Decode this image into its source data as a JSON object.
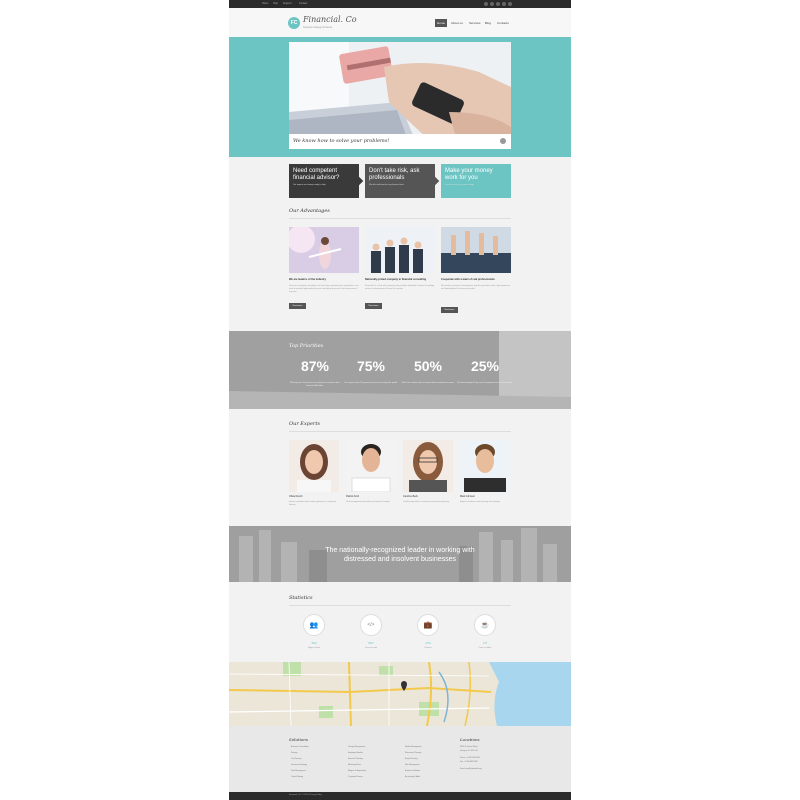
{
  "colors": {
    "accent": "#6cc5c3",
    "dark": "#333333",
    "gray": "#555555"
  },
  "topbar": {
    "links": [
      "Home",
      "Help",
      "Support",
      "Contact"
    ],
    "social_icons": [
      "facebook-icon",
      "twitter-icon",
      "google-icon",
      "linkedin-icon",
      "rss-icon"
    ]
  },
  "header": {
    "logo_text": "FC",
    "brand": "Financial. Co",
    "tagline": "business strategy & finance",
    "nav": [
      {
        "label": "Home",
        "active": true
      },
      {
        "label": "About us",
        "active": false
      },
      {
        "label": "Services",
        "active": false
      },
      {
        "label": "Blog",
        "active": false
      },
      {
        "label": "Contacts",
        "active": false
      }
    ]
  },
  "hero": {
    "caption": "We know how to solve your problems!"
  },
  "promos": [
    {
      "title": "Need competent financial advisor?",
      "sub": "Our experts are always ready to help"
    },
    {
      "title": "Don't take risk, ask professionals",
      "sub": "We offer solutions for any financial task"
    },
    {
      "title": "Make your money work for you",
      "sub": "Learn how to invest your savings"
    }
  ],
  "advantages": {
    "title": "Our Advantages",
    "button": "Read more",
    "items": [
      {
        "heading": "We are leaders of the industry",
        "text": "Since our company's foundation we have been gathering true specialists in our team to provide high-quality financial consulting services to the businesses of any size."
      },
      {
        "heading": "Nationally-prized company in financial consulting",
        "text": "Financial Co. is the only company who provides affordable financial consulting services to businesses all over the country."
      },
      {
        "heading": "Cooperate with a team of real professionals",
        "text": "We involve in business development only the specialists with a big experience and knowledge of the financial market."
      }
    ]
  },
  "priorities": {
    "title": "Top Priorities",
    "items": [
      {
        "value": "87%",
        "text": "We help over 87 percent of our clients to overcome their financial difficulties."
      },
      {
        "value": "75%",
        "text": "Our experts have 75 percent of success in rising their profits."
      },
      {
        "value": "50%",
        "text": "Half of our clients have increased their investment revenue."
      },
      {
        "value": "25%",
        "text": "We have brought 25 percent of companies back to the market."
      }
    ]
  },
  "experts": {
    "title": "Our Experts",
    "items": [
      {
        "name": "Olivia Dunch",
        "text": "Senior consultant with a wide experience in corporate finance."
      },
      {
        "name": "Patrick Ford",
        "text": "Risk management specialist and financial analyst."
      },
      {
        "name": "Caroline Beck",
        "text": "Certified specialist in investment and asset planning."
      },
      {
        "name": "Mark Johnson",
        "text": "Expert in business restructuring and strategy."
      }
    ]
  },
  "leader": {
    "line1": "The nationally-recognized leader in working with",
    "line2": "distressed and insolvent businesses"
  },
  "statistics": {
    "title": "Statistics",
    "items": [
      {
        "icon": "users-icon",
        "glyph": "👥",
        "value": "1540",
        "label": "Happy clients"
      },
      {
        "icon": "code-icon",
        "glyph": "</>",
        "value": "9697",
        "label": "Lines of code"
      },
      {
        "icon": "briefcase-icon",
        "glyph": "💼",
        "value": "2719",
        "label": "Projects"
      },
      {
        "icon": "coffee-icon",
        "glyph": "☕",
        "value": "473",
        "label": "Cups of coffee"
      }
    ]
  },
  "footer": {
    "solutions_title": "Solutions",
    "locations_title": "Locations",
    "col1": [
      "Business Consultation",
      "Savings",
      "Tax Planning",
      "Investment Strategy",
      "Debt Management",
      "Capital Raising",
      "Insurance Advice"
    ],
    "col2": [
      "Change Management",
      "Employee Benefits",
      "Financial Planning",
      "Marketing Plans",
      "Mergers & Acquisitions",
      "Corporate Finance",
      "Strategy"
    ],
    "col3": [
      "Wealth Management",
      "Retirement Planning",
      "Estate Planning",
      "Risk Management",
      "Business Valuation",
      "Accounting & Audit",
      "Trust Services"
    ],
    "locations": [
      "9870 St Vincent Place,",
      "Glasgow, DC 45 Fr 45.",
      "Phone: +1 800 603 6035",
      "Fax: +1 800 889 9898",
      "E-mail: mail@demolink.org"
    ],
    "copyright": "Financial. Co © 2015 | Privacy Policy"
  }
}
